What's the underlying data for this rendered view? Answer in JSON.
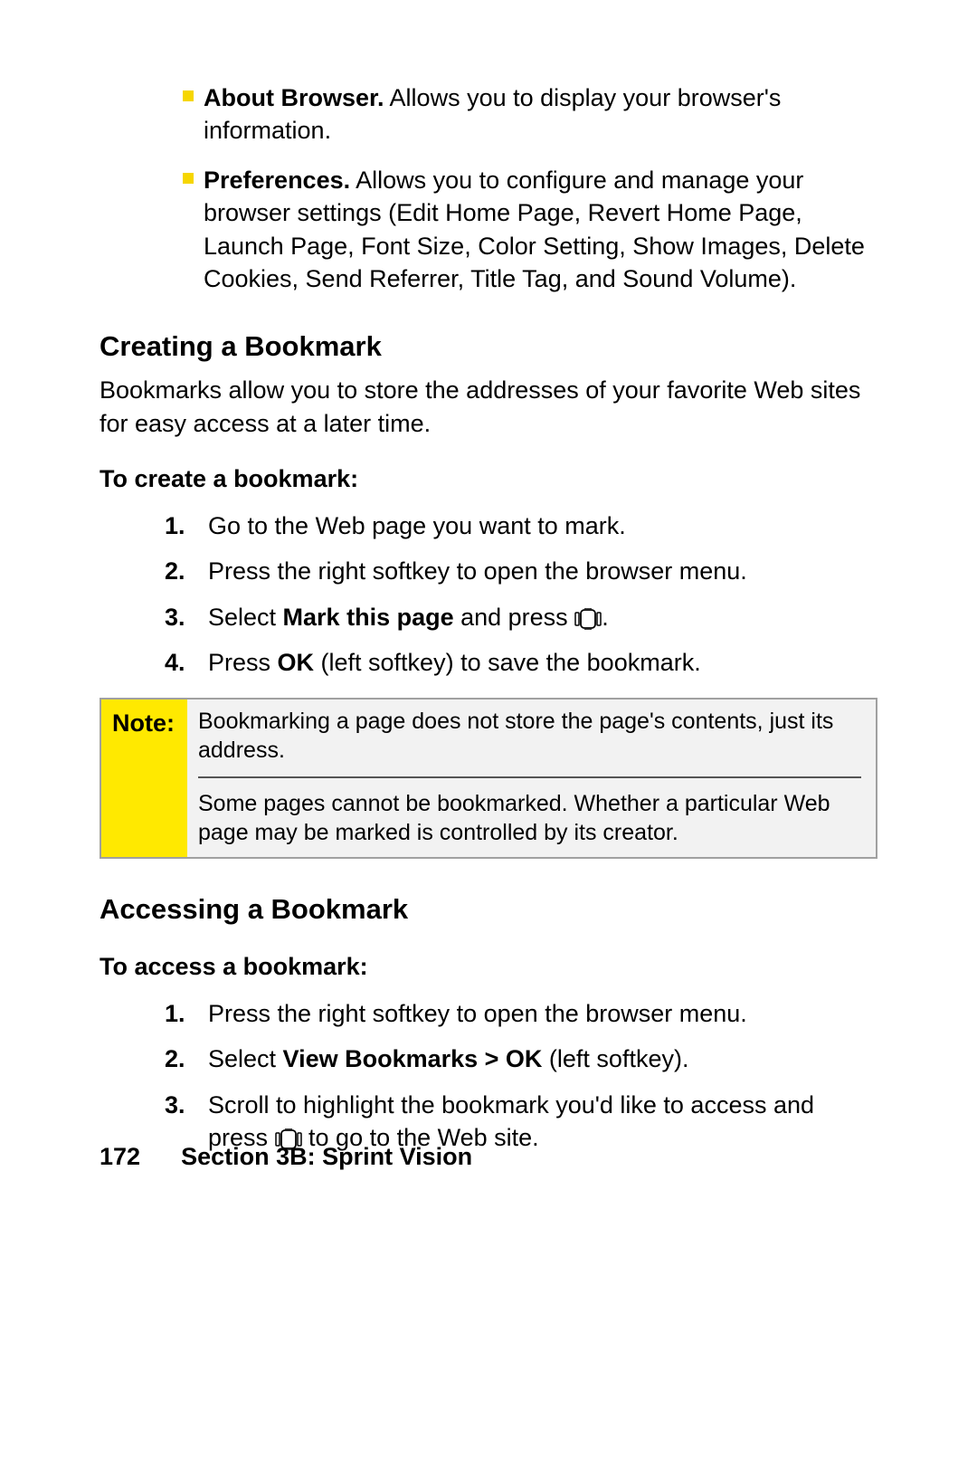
{
  "top_bullets": [
    {
      "bold": "About Browser.",
      "text": " Allows you to display your browser's information."
    },
    {
      "bold": "Preferences.",
      "text": " Allows you to configure and manage your browser settings (Edit Home Page, Revert Home Page, Launch Page, Font Size, Color Setting, Show Images, Delete Cookies, Send Referrer, Title Tag, and Sound Volume)."
    }
  ],
  "section1": {
    "heading": "Creating a Bookmark",
    "intro": "Bookmarks allow you to store the addresses of your favorite Web sites for easy access at a later time.",
    "subhead": "To create a bookmark:",
    "steps": {
      "s1": "Go to the Web page you want to mark.",
      "s2": "Press the right softkey to open the browser menu.",
      "s3_a": "Select ",
      "s3_bold": "Mark this page",
      "s3_b": " and press ",
      "s3_c": ".",
      "s4_a": "Press ",
      "s4_bold": "OK",
      "s4_b": " (left softkey) to save the bookmark."
    }
  },
  "note": {
    "label": "Note:",
    "para1": "Bookmarking a page does not store the page's contents, just its address.",
    "para2": "Some pages cannot be bookmarked. Whether a particular Web page may be marked is controlled by its creator."
  },
  "section2": {
    "heading": "Accessing a Bookmark",
    "subhead": "To access a bookmark:",
    "steps": {
      "s1": "Press the right softkey to open the browser menu.",
      "s2_a": "Select ",
      "s2_bold": "View Bookmarks > OK",
      "s2_b": " (left softkey).",
      "s3_a": "Scroll to highlight the bookmark you'd like to access and press ",
      "s3_b": " to go to the Web site."
    }
  },
  "footer": {
    "page_num": "172",
    "section": "Section 3B: Sprint Vision"
  }
}
